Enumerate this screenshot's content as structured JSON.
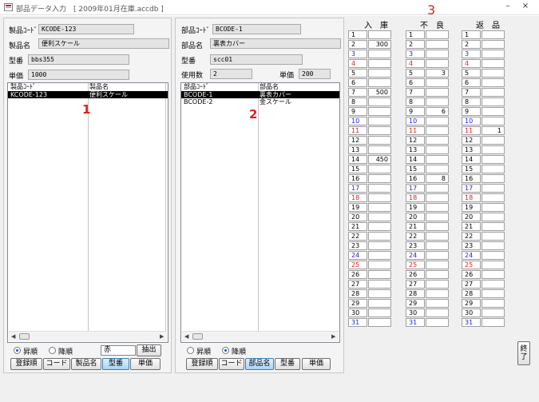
{
  "window": {
    "title": "部品データ入力　[ 2009年01月在庫.accdb ]",
    "minimize": "–",
    "close": "×"
  },
  "product": {
    "code_label": "製品ｺｰﾄﾞ",
    "code_value": "KCODE-123",
    "name_label": "製品名",
    "name_value": "便利スケール",
    "model_label": "型番",
    "model_value": "bbs355",
    "price_label": "単価",
    "price_value": "1000",
    "list": {
      "headers": [
        "製品ｺｰﾄﾞ",
        "製品名"
      ],
      "rows": [
        [
          "KCODE-123",
          "便利スケール"
        ]
      ],
      "selected_index": 0,
      "marker": "1"
    },
    "sort": {
      "asc_label": "昇順",
      "desc_label": "降順",
      "selected": "asc"
    },
    "filter_value": "赤",
    "extract_label": "抽出",
    "buttons": [
      "登録順",
      "コード",
      "製品名",
      "型番",
      "単価"
    ],
    "active_button": "型番"
  },
  "part": {
    "code_label": "部品ｺｰﾄﾞ",
    "code_value": "BCODE-1",
    "name_label": "部品名",
    "name_value": "裏表カバー",
    "model_label": "型番",
    "model_value": "scc01",
    "qty_label": "使用数",
    "qty_value": "2",
    "price_label": "単価",
    "price_value": "200",
    "list": {
      "headers": [
        "部品ｺｰﾄﾞ",
        "部品名"
      ],
      "rows": [
        [
          "BCODE-1",
          "裏表カバー"
        ],
        [
          "BCODE-2",
          "金スケール"
        ]
      ],
      "selected_index": 0,
      "marker": "2"
    },
    "sort": {
      "asc_label": "昇順",
      "desc_label": "降順",
      "selected": "desc"
    },
    "buttons": [
      "登録順",
      "コード",
      "部品名",
      "型番",
      "単価"
    ],
    "active_button": "部品名"
  },
  "ledger": {
    "marker": "3",
    "columns": [
      {
        "title": "入　庫",
        "values": {
          "2": "300",
          "7": "500",
          "14": "450"
        }
      },
      {
        "title": "不　良",
        "values": {
          "5": "3",
          "9": "6",
          "16": "8"
        }
      },
      {
        "title": "返　品",
        "values": {
          "11": "1"
        }
      }
    ],
    "days": [
      "1",
      "2",
      "3",
      "4",
      "5",
      "6",
      "7",
      "8",
      "9",
      "10",
      "11",
      "12",
      "13",
      "14",
      "15",
      "16",
      "17",
      "18",
      "19",
      "20",
      "21",
      "22",
      "23",
      "24",
      "25",
      "26",
      "27",
      "28",
      "29",
      "30",
      "31"
    ],
    "day_colors": {
      "3": "blue",
      "4": "red",
      "10": "blue",
      "11": "red",
      "17": "blue",
      "18": "red",
      "24": "blue",
      "25": "red",
      "31": "blue"
    }
  },
  "exit_label": "終了"
}
